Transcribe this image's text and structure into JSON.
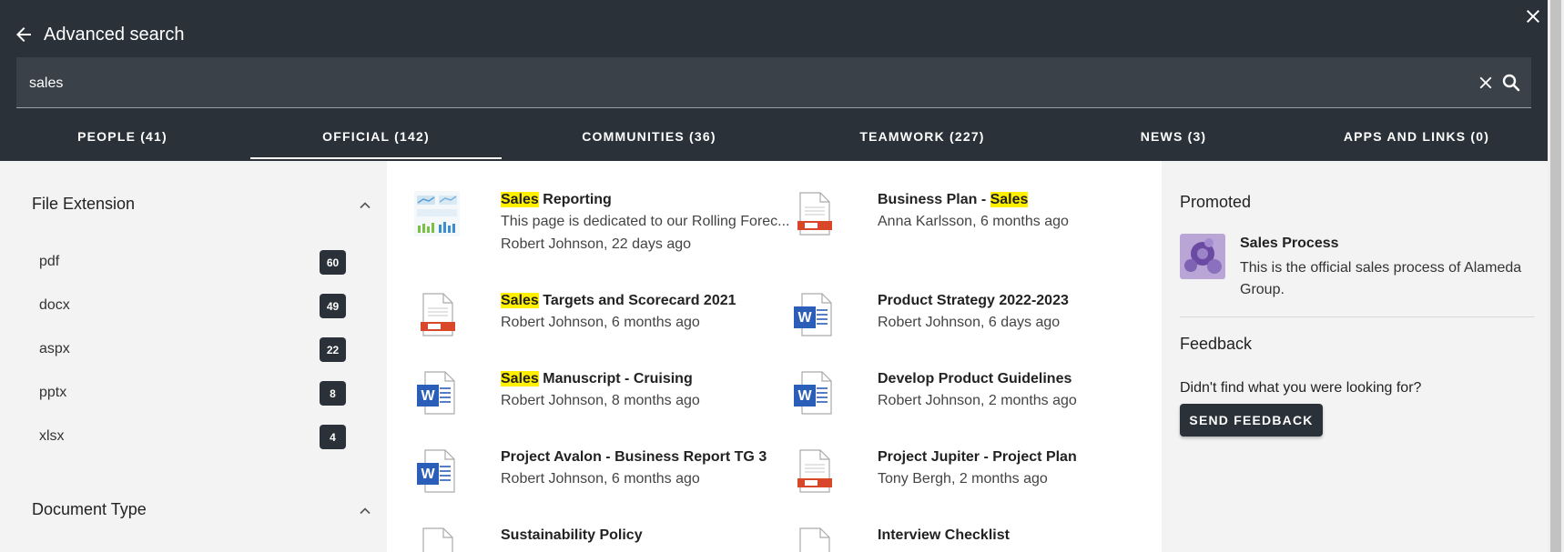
{
  "header": {
    "title": "Advanced search"
  },
  "search": {
    "value": "sales"
  },
  "tabs": [
    {
      "label": "PEOPLE (41)"
    },
    {
      "label": "OFFICIAL (142)"
    },
    {
      "label": "COMMUNITIES (36)"
    },
    {
      "label": "TEAMWORK (227)"
    },
    {
      "label": "NEWS (3)"
    },
    {
      "label": "APPS AND LINKS (0)"
    }
  ],
  "active_tab": "OFFICIAL (142)",
  "facets": {
    "file_extension": {
      "title": "File Extension",
      "items": [
        {
          "label": "pdf",
          "count": "60"
        },
        {
          "label": "docx",
          "count": "49"
        },
        {
          "label": "aspx",
          "count": "22"
        },
        {
          "label": "pptx",
          "count": "8"
        },
        {
          "label": "xlsx",
          "count": "4"
        }
      ]
    },
    "document_type": {
      "title": "Document Type"
    }
  },
  "results": [
    {
      "pre": "",
      "hl": "Sales",
      "post": " Reporting",
      "desc": "This page is dedicated to our Rolling Forec...",
      "meta": "Robert Johnson, 22 days ago",
      "icon": "chart-thumbnail-icon"
    },
    {
      "pre": "Business Plan - ",
      "hl": "Sales",
      "post": "",
      "desc": "",
      "meta": "Anna Karlsson, 6 months ago",
      "icon": "pdf-file-icon"
    },
    {
      "pre": "",
      "hl": "Sales",
      "post": " Targets and Scorecard 2021",
      "desc": "",
      "meta": "Robert Johnson, 6 months ago",
      "icon": "pdf-file-icon"
    },
    {
      "pre": "Product Strategy 2022-2023",
      "hl": "",
      "post": "",
      "desc": "",
      "meta": "Robert Johnson, 6 days ago",
      "icon": "word-file-icon"
    },
    {
      "pre": "",
      "hl": "Sales",
      "post": " Manuscript - Cruising",
      "desc": "",
      "meta": "Robert Johnson, 8 months ago",
      "icon": "word-file-icon"
    },
    {
      "pre": "Develop Product Guidelines",
      "hl": "",
      "post": "",
      "desc": "",
      "meta": "Robert Johnson, 2 months ago",
      "icon": "word-file-icon"
    },
    {
      "pre": "Project Avalon - Business Report TG 3",
      "hl": "",
      "post": "",
      "desc": "",
      "meta": "Robert Johnson, 6 months ago",
      "icon": "word-file-icon"
    },
    {
      "pre": "Project Jupiter - Project Plan",
      "hl": "",
      "post": "",
      "desc": "",
      "meta": "Tony Bergh, 2 months ago",
      "icon": "pdf-file-icon"
    },
    {
      "pre": "Sustainability Policy",
      "hl": "",
      "post": "",
      "desc": "",
      "meta": "",
      "icon": "file-icon"
    },
    {
      "pre": "Interview Checklist",
      "hl": "",
      "post": "",
      "desc": "",
      "meta": "",
      "icon": "file-icon"
    }
  ],
  "side": {
    "promoted_title": "Promoted",
    "promo": {
      "title": "Sales Process",
      "desc": "This is the official sales process of Alameda Group."
    },
    "feedback_title": "Feedback",
    "feedback_question": "Didn't find what you were looking for?",
    "feedback_button": "SEND FEEDBACK"
  },
  "colors": {
    "header_bg": "#2a3138",
    "highlight": "#ffef00",
    "badge_bg": "#2a3138"
  }
}
